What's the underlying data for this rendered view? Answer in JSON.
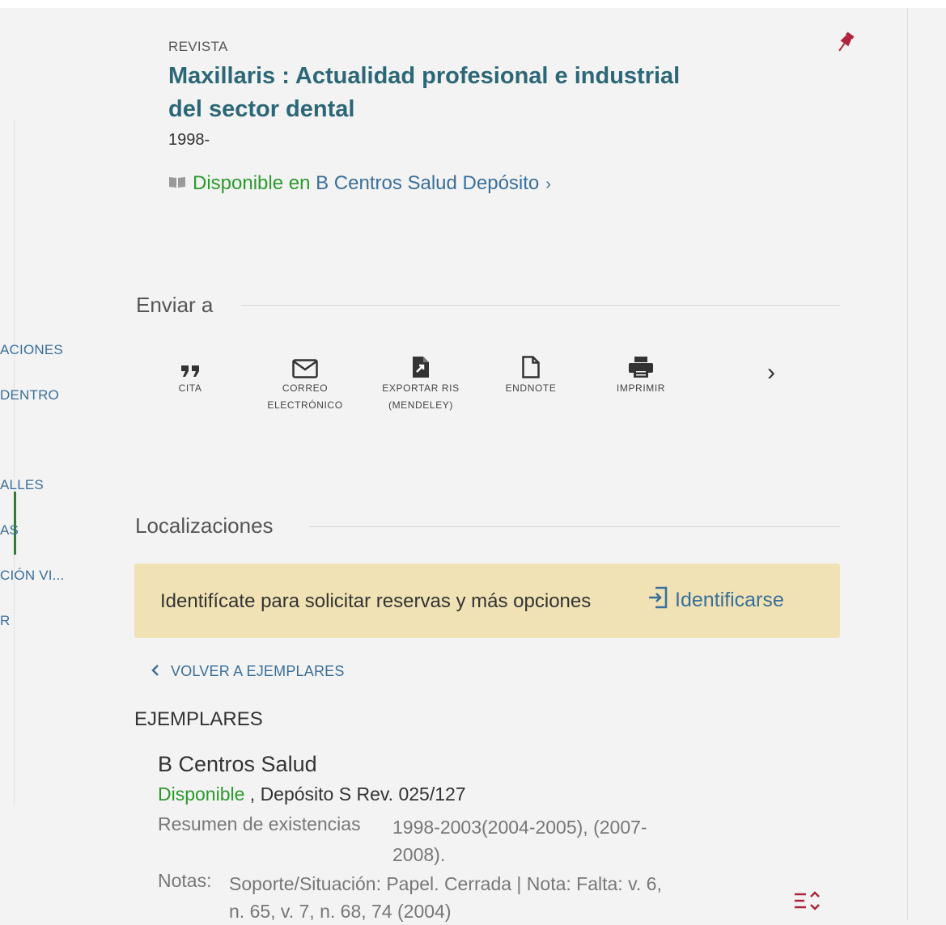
{
  "record": {
    "type_label": "REVISTA",
    "title": "Maxillaris : Actualidad profesional e industrial del sector dental",
    "year": "1998-",
    "availability": {
      "prefix": "Disponible en",
      "library": "B Centros Salud",
      "location": "Depósito",
      "chevron": "›"
    }
  },
  "left_nav": [
    {
      "label": "ACIONES",
      "active": false
    },
    {
      "label": "DENTRO",
      "active": false
    },
    {
      "label": "ALLES",
      "active": false
    },
    {
      "label": "AS",
      "active": true
    },
    {
      "label": "CIÓN VI...",
      "active": false
    },
    {
      "label": "R",
      "active": false
    }
  ],
  "send_to": {
    "title": "Enviar a",
    "items": [
      {
        "label": "CITA",
        "icon": "quote-icon"
      },
      {
        "label": "CORREO ELECTRÓNICO",
        "icon": "envelope-icon"
      },
      {
        "label": "EXPORTAR RIS (MENDELEY)",
        "icon": "file-export-icon"
      },
      {
        "label": "ENDNOTE",
        "icon": "file-icon"
      },
      {
        "label": "IMPRIMIR",
        "icon": "printer-icon"
      }
    ],
    "next": "›"
  },
  "locations": {
    "title": "Localizaciones",
    "banner_text": "Identifícate para solicitar reservas y más opciones",
    "signin_label": "Identificarse",
    "back_label": "VOLVER A EJEMPLARES",
    "items_title": "EJEMPLARES",
    "branch": "B Centros Salud",
    "status": "Disponible",
    "status_detail": " , Depósito S Rev. 025/127",
    "summary_label": "Resumen de existencias",
    "summary_value": "1998-2003(2004-2005), (2007-2008).",
    "notes_label": "Notas:",
    "notes_value": "Soporte/Situación: Papel. Cerrada | Nota: Falta: v. 6, n. 65, v. 7, n. 68, 74 (2004)"
  },
  "colors": {
    "link": "#3a6f9a",
    "title": "#2c6777",
    "available": "#2b9a2b",
    "banner": "#f0e2b4",
    "pin": "#b0233a"
  }
}
